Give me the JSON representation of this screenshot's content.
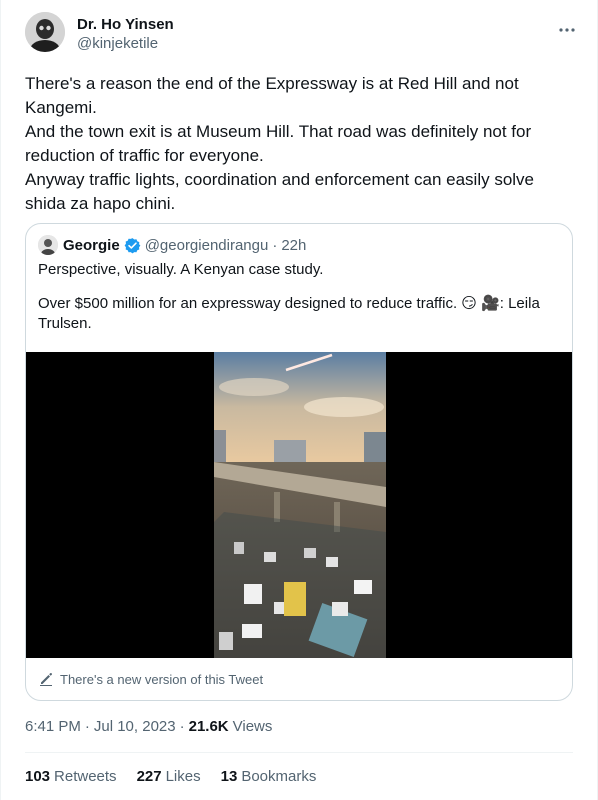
{
  "author": {
    "display_name": "Dr. Ho Yinsen",
    "handle": "@kinjeketile"
  },
  "tweet": {
    "lines": [
      "There's a reason the end of the Expressway is at Red Hill and not Kangemi.",
      "And the town exit is at Museum Hill. That road was definitely not for reduction of traffic for everyone.",
      "Anyway traffic lights, coordination and enforcement can easily solve shida za hapo chini."
    ]
  },
  "quote": {
    "display_name": "Georgie",
    "handle": "@georgiendirangu",
    "time": "22h",
    "line1": "Perspective, visually. A Kenyan case study.",
    "line2": "Over $500 million for an expressway designed to reduce traffic. 😏 🎥: Leila Trulsen.",
    "new_version_notice": "There's a new version of this Tweet"
  },
  "meta": {
    "time": "6:41 PM",
    "date": "Jul 10, 2023",
    "views_count": "21.6K",
    "views_label": "Views"
  },
  "stats": {
    "retweets_count": "103",
    "retweets_label": "Retweets",
    "likes_count": "227",
    "likes_label": "Likes",
    "bookmarks_count": "13",
    "bookmarks_label": "Bookmarks"
  },
  "colors": {
    "text_primary": "#0f1419",
    "text_secondary": "#536471",
    "border": "#cfd9de",
    "verified_blue": "#1d9bf0"
  },
  "icons": {
    "more": "more-horizontal-icon",
    "verified": "verified-badge-icon",
    "edit": "pencil-edit-icon"
  }
}
